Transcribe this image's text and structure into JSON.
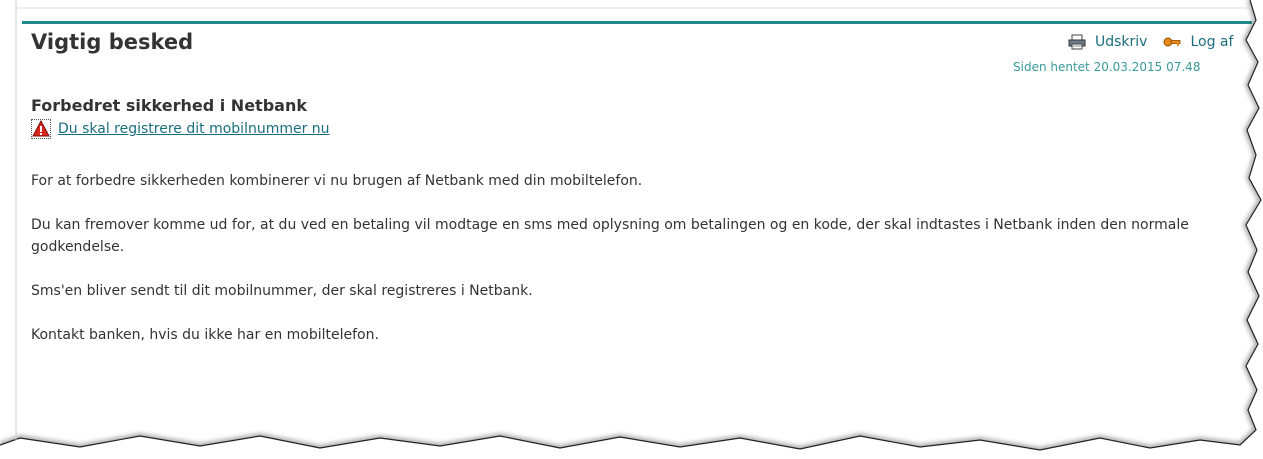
{
  "header": {
    "title": "Vigtig besked",
    "print_label": "Udskriv",
    "logout_label": "Log af",
    "retrieved": "Siden hentet 20.03.2015 07.48"
  },
  "content": {
    "section_title": "Forbedret sikkerhed i Netbank",
    "warning_link": "Du skal registrere dit mobilnummer nu",
    "paragraphs": [
      "For at forbedre sikkerheden kombinerer vi nu brugen af Netbank med din mobiltelefon.",
      "Du kan fremover komme ud for, at du ved en betaling vil modtage en sms med oplysning om betalingen og en kode, der skal indtastes i Netbank inden den normale godkendelse.",
      "Sms'en bliver sendt til dit mobilnummer, der skal registreres i Netbank.",
      "Kontakt banken, hvis du ikke har en mobiltelefon."
    ]
  },
  "icons": {
    "print": "printer-icon",
    "logout": "key-icon",
    "warning": "warning-icon"
  },
  "colors": {
    "accent": "#1f8a8a",
    "link": "#1a6e7e",
    "text": "#333333",
    "warning": "#d9261c"
  }
}
